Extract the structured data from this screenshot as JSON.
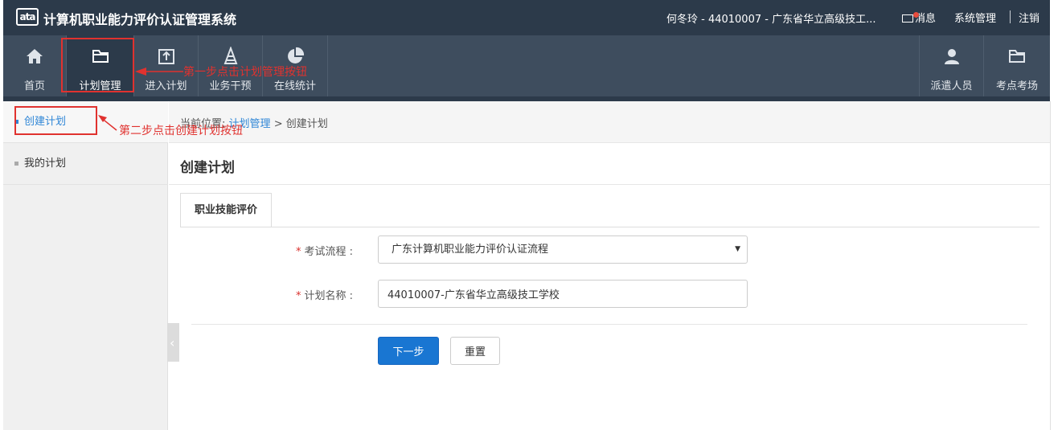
{
  "header": {
    "logo_text": "ata",
    "app_title": "计算机职业能力评价认证管理系统",
    "user_info": "何冬玲 - 44010007 - 广东省华立高级技工...",
    "messages_label": "消息",
    "system_mgmt_label": "系统管理",
    "logout_label": "注销"
  },
  "nav": {
    "items": [
      {
        "label": "首页",
        "icon": "home-icon"
      },
      {
        "label": "计划管理",
        "icon": "folder-icon"
      },
      {
        "label": "进入计划",
        "icon": "enter-plan-icon"
      },
      {
        "label": "业务干预",
        "icon": "cone-icon"
      },
      {
        "label": "在线统计",
        "icon": "pie-chart-icon"
      }
    ],
    "right_items": [
      {
        "label": "派遣人员",
        "icon": "user-icon"
      },
      {
        "label": "考点考场",
        "icon": "folder-icon"
      }
    ]
  },
  "sidebar": {
    "items": [
      {
        "label": "创建计划",
        "active": true
      },
      {
        "label": "我的计划",
        "active": false
      }
    ]
  },
  "breadcrumb": {
    "prefix": "当前位置:",
    "link": "计划管理",
    "separator": ">",
    "current": "创建计划"
  },
  "main": {
    "title": "创建计划",
    "tab_label": "职业技能评价",
    "form": {
      "process_label": "考试流程 :",
      "process_value": "广东计算机职业能力评价认证流程",
      "name_label": "计划名称 :",
      "name_value": "44010007-广东省华立高级技工学校",
      "required_mark": "*"
    },
    "next_button": "下一步",
    "reset_button": "重置"
  },
  "annotations": {
    "step1": "第一步点击计划管理按钮",
    "step2": "第二步点击创建计划按钮",
    "color": "#e0322f"
  }
}
